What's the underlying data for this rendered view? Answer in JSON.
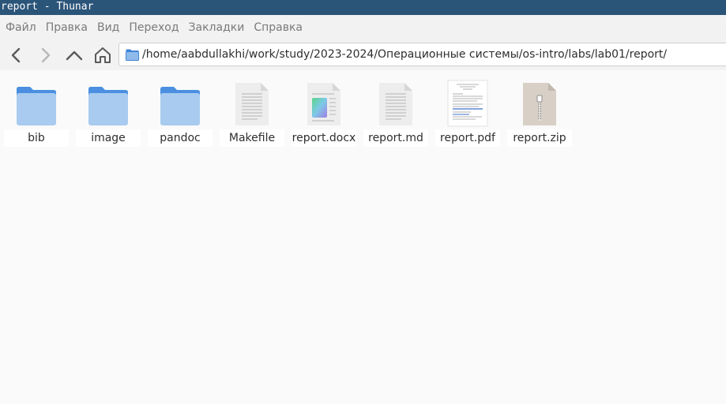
{
  "window": {
    "title": "report - Thunar"
  },
  "menubar": {
    "items": [
      "Файл",
      "Правка",
      "Вид",
      "Переход",
      "Закладки",
      "Справка"
    ]
  },
  "toolbar": {
    "back_icon": "chevron-left-icon",
    "forward_icon": "chevron-right-icon",
    "up_icon": "chevron-up-icon",
    "home_icon": "home-icon",
    "path": "/home/aabdullakhi/work/study/2023-2024/Операционные системы/os-intro/labs/lab01/report/"
  },
  "files": [
    {
      "name": "bib",
      "type": "folder"
    },
    {
      "name": "image",
      "type": "folder"
    },
    {
      "name": "pandoc",
      "type": "folder"
    },
    {
      "name": "Makefile",
      "type": "text"
    },
    {
      "name": "report.docx",
      "type": "docx"
    },
    {
      "name": "report.md",
      "type": "text"
    },
    {
      "name": "report.pdf",
      "type": "pdf"
    },
    {
      "name": "report.zip",
      "type": "zip"
    }
  ],
  "colors": {
    "titlebar_bg": "#2b5479",
    "folder_body": "#a8cbef",
    "folder_tab": "#4a8fe0",
    "menu_text": "#7a7a7a"
  }
}
